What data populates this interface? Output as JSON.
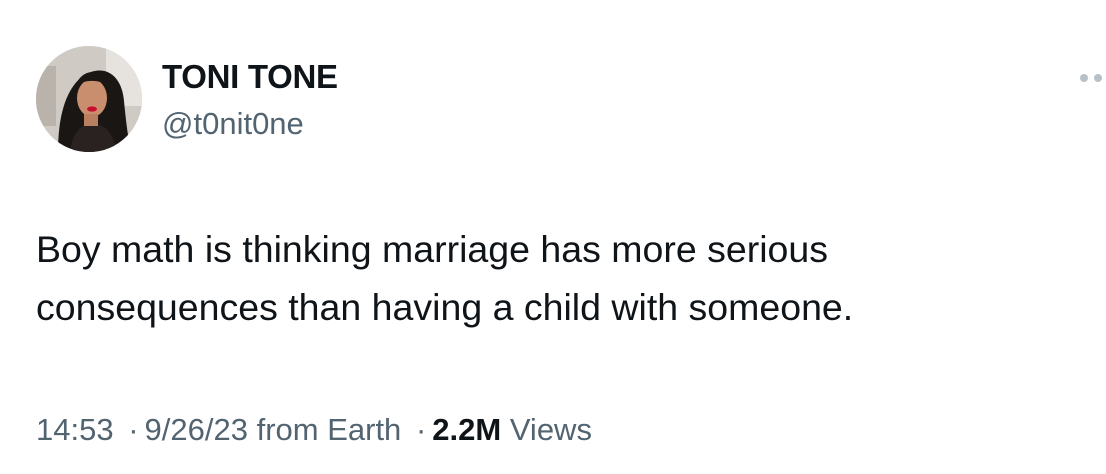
{
  "author": {
    "display_name": "TONI TONE",
    "handle": "@t0nit0ne",
    "avatar_icon": "profile-photo"
  },
  "menu": {
    "icon": "more-options-icon"
  },
  "tweet": {
    "text": "Boy math is thinking marriage has more serious consequences than having a child with someone."
  },
  "meta": {
    "time": "14:53",
    "date": "9/26/23",
    "source": "from Earth",
    "separator": "·",
    "views_count": "2.2M",
    "views_label": "Views"
  },
  "colors": {
    "primary_text": "#0f1419",
    "secondary_text": "#536471",
    "background": "#ffffff"
  }
}
